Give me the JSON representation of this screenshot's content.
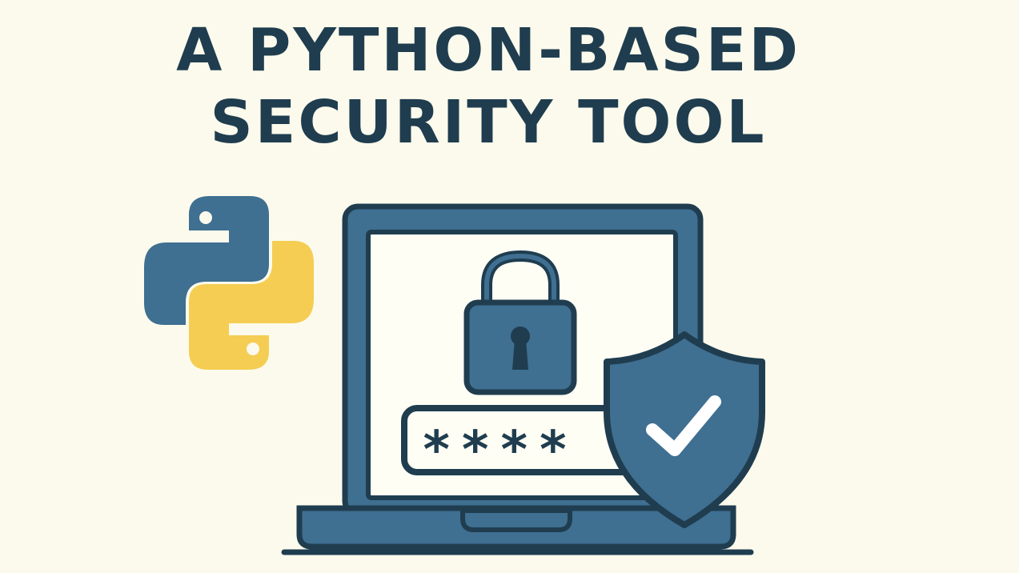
{
  "title": {
    "line1": "A PYTHON-BASED",
    "line2": "SECURITY TOOL"
  },
  "illustration": {
    "password_field": {
      "masked_value": "****"
    },
    "icons": [
      "python-logo-icon",
      "laptop-icon",
      "padlock-icon",
      "shield-check-icon"
    ]
  },
  "colors": {
    "background": "#fcfaec",
    "dark_blue": "#1f3d4f",
    "python_blue": "#3f6f91",
    "python_yellow": "#f4cd52",
    "screen_white": "#fffef5"
  }
}
